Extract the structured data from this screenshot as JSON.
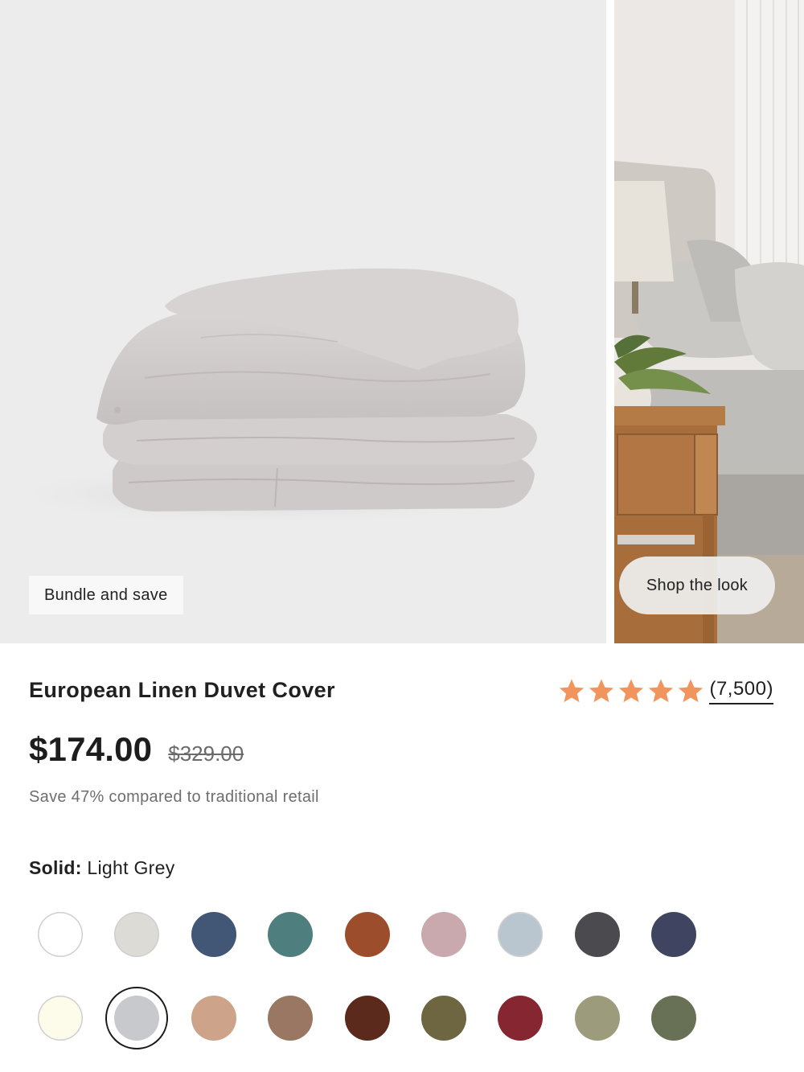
{
  "gallery": {
    "badge_label": "Bundle and save",
    "shop_look_label": "Shop the look"
  },
  "product": {
    "title": "European Linen Duvet Cover",
    "rating": {
      "stars": 5,
      "review_count": "(7,500)",
      "star_color": "#f2955c"
    },
    "price": "$174.00",
    "original_price": "$329.00",
    "savings_text": "Save 47% compared to traditional retail"
  },
  "color_picker": {
    "group_label": "Solid:",
    "selected_name": "Light Grey",
    "selected_index": 10,
    "swatches": [
      "#ffffff",
      "#dcdbd6",
      "#425675",
      "#4f7e7e",
      "#9c4e2c",
      "#c9a9ad",
      "#b9c6cf",
      "#4b4b4f",
      "#3f4560",
      "#fdfbea",
      "#c7c9cc",
      "#cda38a",
      "#9a7763",
      "#5c2a1c",
      "#6e6541",
      "#852631",
      "#9c9b7c",
      "#687055"
    ]
  }
}
